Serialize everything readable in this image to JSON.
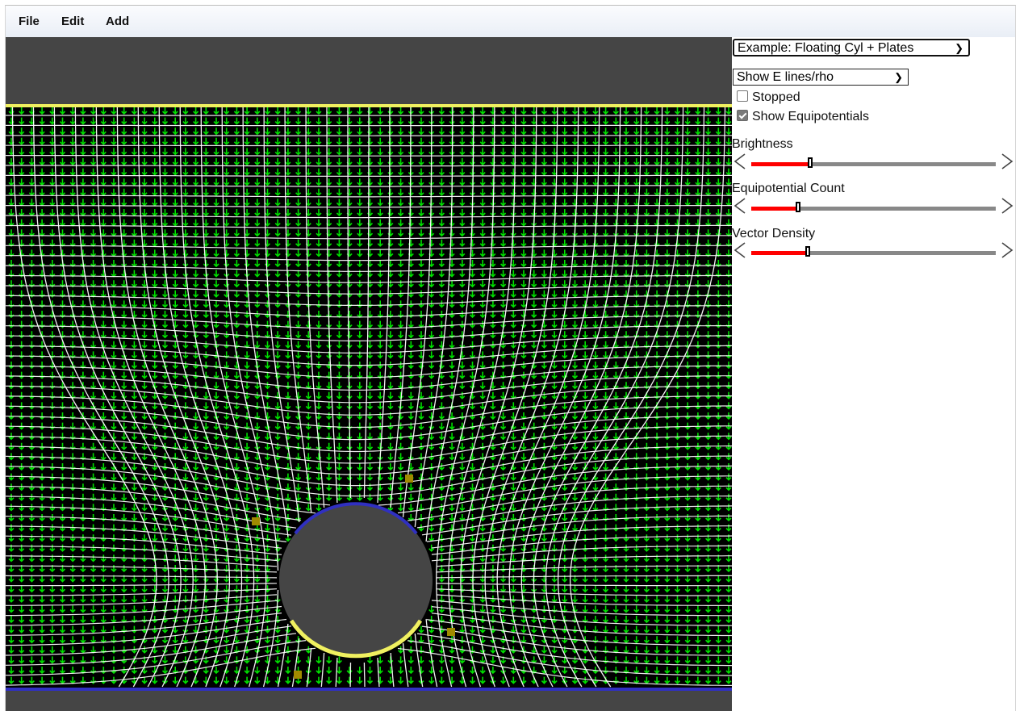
{
  "menu": {
    "items": [
      "File",
      "Edit",
      "Add"
    ]
  },
  "controls": {
    "example_select": "Example: Floating Cyl + Plates",
    "display_select": "Show E lines/rho",
    "stopped_label": "Stopped",
    "stopped": false,
    "equipotentials_label": "Show Equipotentials",
    "equipotentials": true
  },
  "sliders": [
    {
      "label": "Brightness",
      "value": 0.24
    },
    {
      "label": "Equipotential Count",
      "value": 0.19
    },
    {
      "label": "Vector Density",
      "value": 0.23
    }
  ],
  "icons": {
    "decrease": "chevron-left-icon",
    "increase": "chevron-right-icon",
    "dropdown": "chevron-down-icon",
    "vector": "down-arrow-icon"
  },
  "colors": {
    "field_background": "#000000",
    "plate_top": "#f0f060",
    "plate_bottom": "#3030c0",
    "conductor": "#454545",
    "vector": "#00e000",
    "lines": "#ffffff",
    "slider_fill": "#ff0000",
    "charge": "#a08a00"
  }
}
